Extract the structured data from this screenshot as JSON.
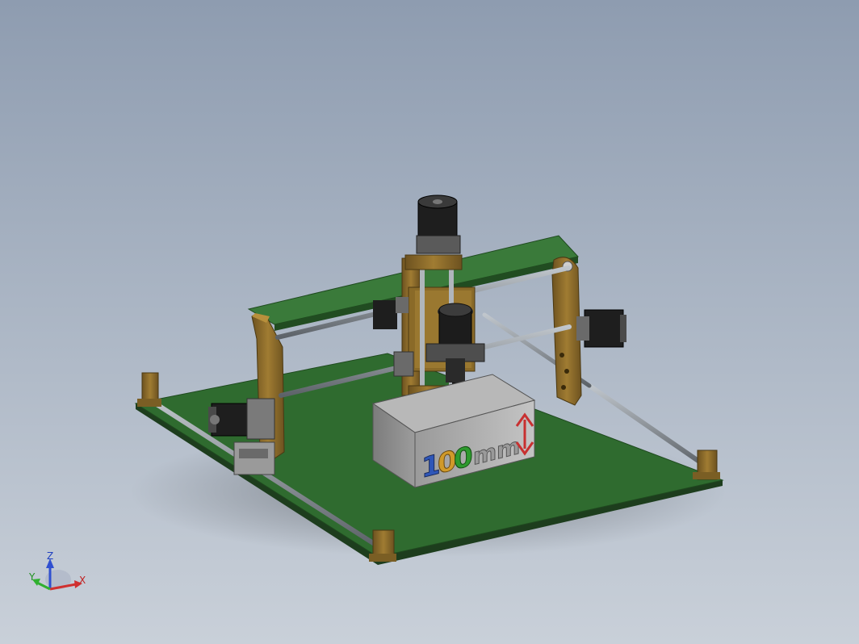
{
  "model": {
    "block_text_digits": "100",
    "block_text_unit": "mm"
  },
  "triad": {
    "z_label": "Z",
    "y_label": "Y",
    "x_label": "X"
  },
  "colors": {
    "background_top": "#8e9cb0",
    "background_bottom": "#c9d0d9",
    "base_plate": "#2c6a2c",
    "frame_wood": "#8a6a28",
    "rod_steel": "#8e969c",
    "motor_black": "#222222",
    "block_grey": "#b4b4b4",
    "axis_x": "#d03030",
    "axis_y": "#30b030",
    "axis_z": "#3050d0"
  }
}
